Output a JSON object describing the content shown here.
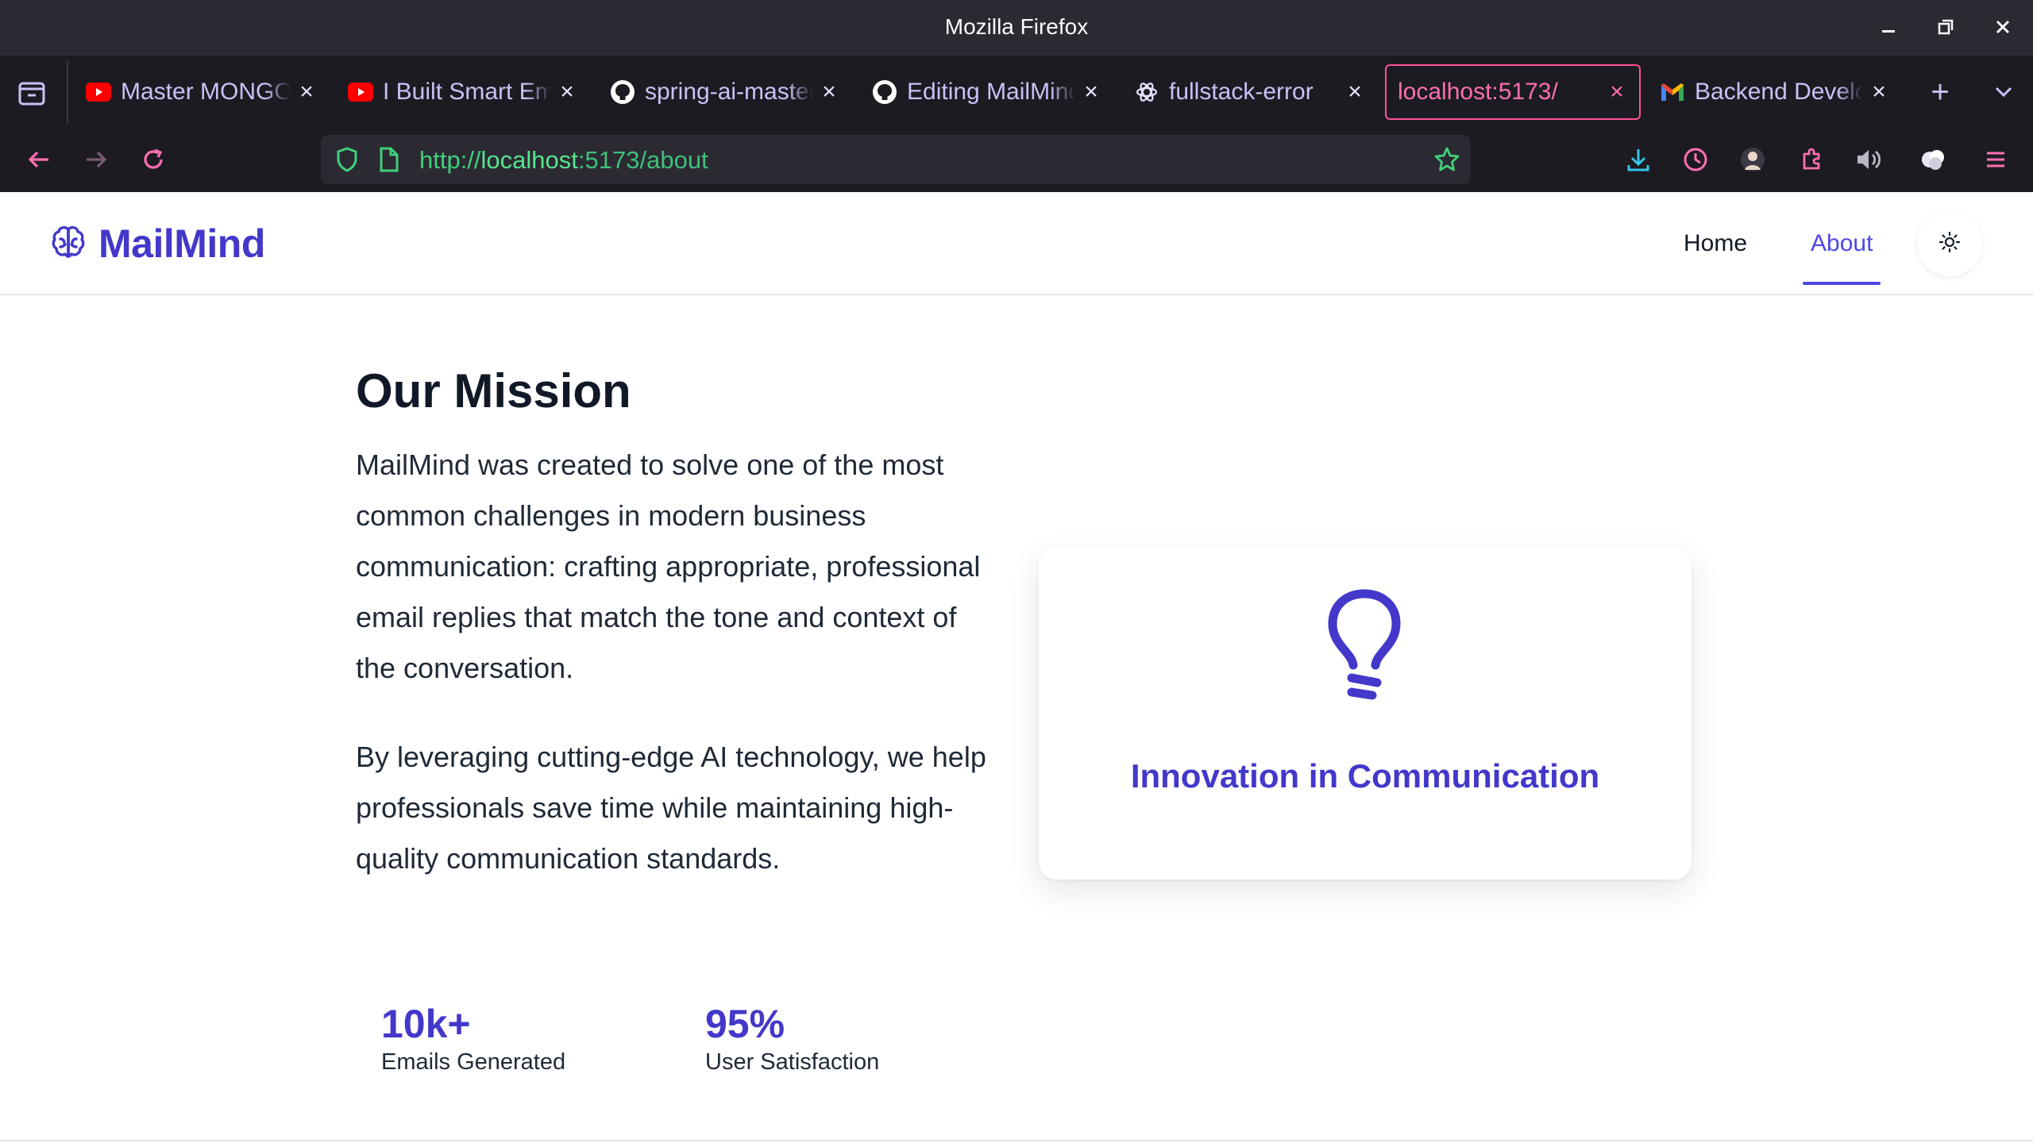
{
  "window": {
    "title": "Mozilla Firefox"
  },
  "tabs": [
    {
      "label": "Master MONGODB",
      "icon": "youtube-icon"
    },
    {
      "label": "I Built Smart Email",
      "icon": "youtube-icon"
    },
    {
      "label": "spring-ai-master",
      "icon": "github-icon"
    },
    {
      "label": "Editing MailMind",
      "icon": "github-icon"
    },
    {
      "label": "fullstack-error",
      "icon": "openai-icon"
    },
    {
      "label": "localhost:5173/",
      "icon": "",
      "active": true
    },
    {
      "label": "Backend Developer",
      "icon": "gmail-icon"
    }
  ],
  "url": {
    "scheme": "http://",
    "host": "localhost",
    "rest": ":5173/about"
  },
  "site": {
    "brand": "MailMind",
    "nav": {
      "home": "Home",
      "about": "About"
    }
  },
  "mission": {
    "title": "Our Mission",
    "p1": "MailMind was created to solve one of the most common challenges in modern business communication: crafting appropriate, professional email replies that match the tone and context of the conversation.",
    "p2": "By leveraging cutting-edge AI technology, we help professionals save time while maintaining high-quality communication standards."
  },
  "stats": [
    {
      "value": "10k+",
      "label": "Emails Generated"
    },
    {
      "value": "95%",
      "label": "User Satisfaction"
    }
  ],
  "card": {
    "title": "Innovation in Communication",
    "icon": "lightbulb-icon"
  },
  "colors": {
    "accent": "#4f46e5",
    "brand": "#4338ca",
    "active_tab": "#ff4f9a",
    "url_text": "#3fd17a"
  }
}
